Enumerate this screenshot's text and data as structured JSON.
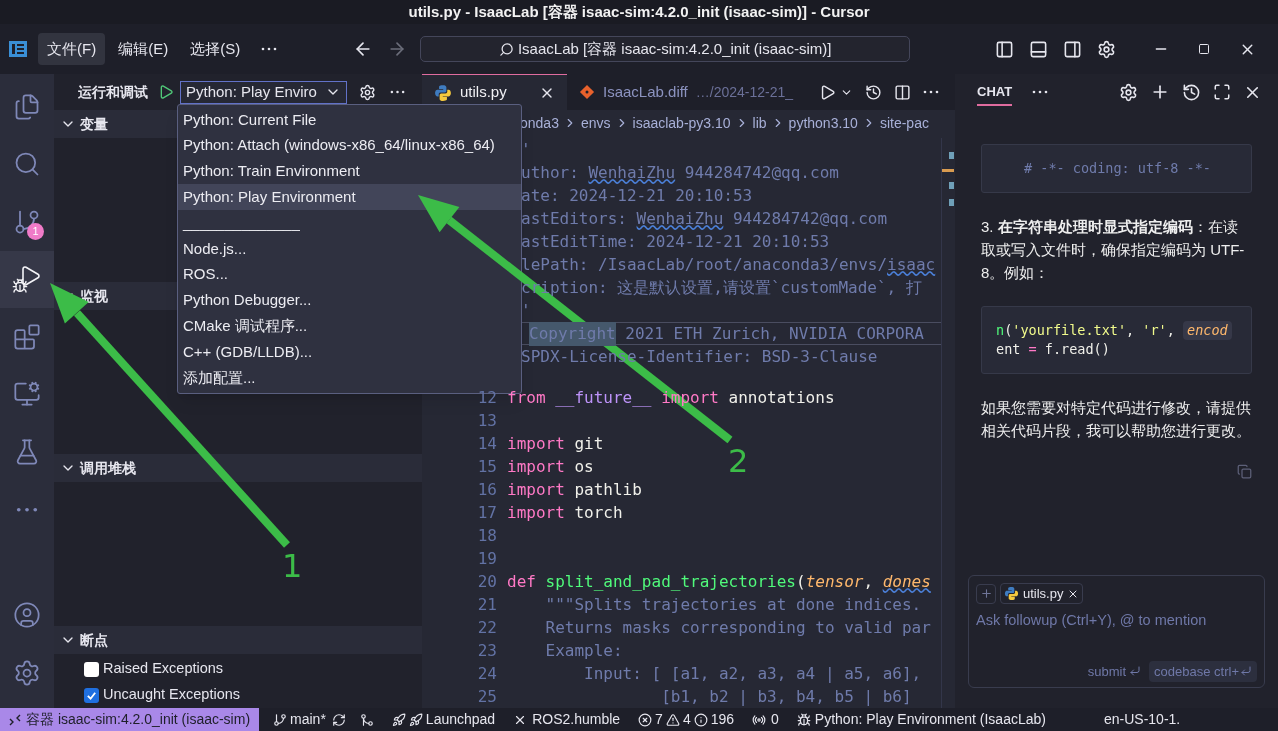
{
  "window": {
    "title": "utils.py - IsaacLab [容器 isaac-sim:4.2.0_init (isaac-sim)] - Cursor"
  },
  "menu_bar": {
    "items": [
      {
        "label": "文件(F)",
        "selected": true
      },
      {
        "label": "编辑(E)",
        "selected": false
      },
      {
        "label": "选择(S)",
        "selected": false
      }
    ]
  },
  "search": {
    "value": "IsaacLab [容器 isaac-sim:4.2.0_init (isaac-sim)]"
  },
  "activity_bar": {
    "items": [
      {
        "kind": "files",
        "selected": false
      },
      {
        "kind": "search",
        "selected": false
      },
      {
        "kind": "source_control",
        "selected": false,
        "badge": "1"
      },
      {
        "kind": "run_debug",
        "selected": true
      },
      {
        "kind": "extensions",
        "selected": false
      },
      {
        "kind": "remote",
        "selected": false
      },
      {
        "kind": "testing",
        "selected": false
      },
      {
        "kind": "more",
        "selected": false
      }
    ],
    "bottom": [
      {
        "kind": "account"
      },
      {
        "kind": "settings"
      }
    ]
  },
  "run_panel": {
    "title": "运行和调试",
    "config": "Python: Play Enviro",
    "sections": [
      {
        "title": "变量",
        "expanded": true
      },
      {
        "title": "监视",
        "expanded": true
      },
      {
        "title": "调用堆栈",
        "expanded": true
      },
      {
        "title": "断点",
        "expanded": true
      }
    ],
    "breakpoints": [
      {
        "label": "Raised Exceptions",
        "checked": false
      },
      {
        "label": "Uncaught Exceptions",
        "checked": true
      }
    ]
  },
  "launch_menu": {
    "items": [
      {
        "label": "Python: Current File",
        "selected": false
      },
      {
        "label": "Python: Attach (windows-x86_64/linux-x86_64)",
        "selected": false
      },
      {
        "label": "Python: Train Environment",
        "selected": false
      },
      {
        "label": "Python: Play Environment",
        "selected": true
      },
      {
        "label": "______________",
        "selected": false
      },
      {
        "label": "Node.js...",
        "selected": false
      },
      {
        "label": "ROS...",
        "selected": false
      },
      {
        "label": "Python Debugger...",
        "selected": false
      },
      {
        "label": "CMake 调试程序...",
        "selected": false
      },
      {
        "label": "C++ (GDB/LLDB)...",
        "selected": false
      },
      {
        "label": "添加配置...",
        "selected": false
      }
    ]
  },
  "editor": {
    "tabs": [
      {
        "kind": "python",
        "label": "utils.py",
        "selected": true
      },
      {
        "kind": "git",
        "label": "IsaacLab.diff",
        "detail": "…/2024-12-21_",
        "selected": false
      }
    ],
    "breadcrumbs": [
      "onda3",
      "envs",
      "isaaclab-py3.10",
      "lib",
      "python3.10",
      "site-pac"
    ],
    "lines": [
      {
        "current": false,
        "tokens": [
          {
            "kind": "comment",
            "text": "'"
          }
        ]
      },
      {
        "current": false,
        "tokens": [
          {
            "kind": "comment",
            "text": "uthor: "
          },
          {
            "kind": "comment_squiggle",
            "text": "WenhaiZhu"
          },
          {
            "kind": "comment",
            "text": " 944284742@qq.com"
          }
        ]
      },
      {
        "current": false,
        "tokens": [
          {
            "kind": "comment",
            "text": "ate: 2024-12-21 20:10:53"
          }
        ]
      },
      {
        "current": false,
        "tokens": [
          {
            "kind": "comment",
            "text": "astEditors: "
          },
          {
            "kind": "comment_squiggle",
            "text": "WenhaiZhu"
          },
          {
            "kind": "comment",
            "text": " 944284742@qq.com"
          }
        ]
      },
      {
        "current": false,
        "tokens": [
          {
            "kind": "comment",
            "text": "astEditTime: 2024-12-21 20:10:53"
          }
        ]
      },
      {
        "current": false,
        "tokens": [
          {
            "kind": "comment",
            "text": "lePath: /IsaacLab/root/anaconda3/envs/"
          },
          {
            "kind": "comment_squiggle",
            "text": "isaac"
          }
        ]
      },
      {
        "current": false,
        "tokens": [
          {
            "kind": "comment",
            "text": "cription: 这是默认设置,请设置`customMade`, 打"
          }
        ]
      },
      {
        "current": false,
        "tokens": [
          {
            "kind": "comment",
            "text": "'"
          }
        ]
      },
      {
        "current": true,
        "tokens": [
          {
            "kind": "selection",
            "text": "Copyright"
          },
          {
            "kind": "comment",
            "text": " 2021 ETH Zurich, NVIDIA CORPORA"
          }
        ]
      },
      {
        "current": false,
        "tokens": [
          {
            "kind": "comment",
            "text": "SPDX-License-Identifier: BSD-3-Clause"
          }
        ]
      },
      {
        "current": false
      },
      {
        "number": "12",
        "current": false,
        "tokens": [
          {
            "kind": "keyword",
            "text": "from"
          },
          {
            "kind": "module",
            "text": " __future__ "
          },
          {
            "kind": "keyword",
            "text": "import"
          },
          {
            "kind": "name",
            "text": " annotations"
          }
        ]
      },
      {
        "number": "13",
        "current": false
      },
      {
        "number": "14",
        "current": false,
        "tokens": [
          {
            "kind": "keyword",
            "text": "import"
          },
          {
            "kind": "name",
            "text": " git"
          }
        ]
      },
      {
        "number": "15",
        "current": false,
        "tokens": [
          {
            "kind": "keyword",
            "text": "import"
          },
          {
            "kind": "name",
            "text": " os"
          }
        ]
      },
      {
        "number": "16",
        "current": false,
        "tokens": [
          {
            "kind": "keyword",
            "text": "import"
          },
          {
            "kind": "name",
            "text": " pathlib"
          }
        ]
      },
      {
        "number": "17",
        "current": false,
        "tokens": [
          {
            "kind": "keyword",
            "text": "import"
          },
          {
            "kind": "name",
            "text": " torch"
          }
        ]
      },
      {
        "number": "18",
        "current": false
      },
      {
        "number": "19",
        "current": false
      },
      {
        "number": "20",
        "current": false,
        "tokens": [
          {
            "kind": "keyword",
            "text": "def "
          },
          {
            "kind": "function",
            "text": "split_and_pad_trajectories"
          },
          {
            "kind": "name",
            "text": "("
          },
          {
            "kind": "param",
            "text": "tensor"
          },
          {
            "kind": "name",
            "text": ", "
          },
          {
            "kind": "param_squiggle",
            "text": "dones"
          }
        ]
      },
      {
        "number": "21",
        "current": false,
        "tokens": [
          {
            "kind": "comment",
            "text": "    \"\"\"Splits trajectories at done indices."
          }
        ]
      },
      {
        "number": "22",
        "current": false,
        "tokens": [
          {
            "kind": "comment",
            "text": "    Returns masks corresponding to valid par"
          }
        ]
      },
      {
        "number": "23",
        "current": false,
        "tokens": [
          {
            "kind": "comment",
            "text": "    Example:"
          }
        ]
      },
      {
        "number": "24",
        "current": false,
        "tokens": [
          {
            "kind": "comment",
            "text": "        Input: [ [a1, a2, a3, a4 | a5, a6],"
          }
        ]
      },
      {
        "number": "25",
        "current": false,
        "tokens": [
          {
            "kind": "comment",
            "text": "                [b1, b2 | b3, b4, b5 | b6]"
          }
        ]
      }
    ]
  },
  "chat": {
    "title": "CHAT",
    "blocks": [
      {
        "kind": "code",
        "lines": [
          [
            {
              "kind": "comment",
              "text": "# -*- coding: utf-8 -*-"
            }
          ]
        ]
      },
      {
        "kind": "text",
        "text": "3. **在字符串处理时显式指定编码**：在读取或写入文件时，确保指定编码为 UTF-8。例如："
      },
      {
        "kind": "code",
        "lines": [
          [
            {
              "kind": "function",
              "text": "n"
            },
            {
              "kind": "name",
              "text": "("
            },
            {
              "kind": "string",
              "text": "'yourfile.txt'"
            },
            {
              "kind": "name",
              "text": ", "
            },
            {
              "kind": "string",
              "text": "'r'"
            },
            {
              "kind": "name",
              "text": ", "
            },
            {
              "kind": "param_box",
              "text": "encod"
            }
          ],
          [
            {
              "kind": "name",
              "text": "ent "
            },
            {
              "kind": "keyword",
              "text": "="
            },
            {
              "kind": "name",
              "text": " f.read()"
            }
          ]
        ]
      },
      {
        "kind": "text",
        "text": "如果您需要对特定代码进行修改，请提供相关代码片段，我可以帮助您进行更改。"
      }
    ],
    "context_chip": "utils.py",
    "input": {
      "placeholder": "Ask followup (Ctrl+Y), @ to mention"
    },
    "submit": "submit",
    "codebase": "codebase ctrl+"
  },
  "status_bar": {
    "remote": "容器 isaac-sim:4.2.0_init (isaac-sim)",
    "items": [
      {
        "kind": "branch",
        "text": "main*"
      },
      {
        "kind": "sync"
      },
      {
        "kind": "merge"
      },
      {
        "kind": "launchpad",
        "text": "Launchpad"
      },
      {
        "kind": "ros",
        "text": "ROS2.humble"
      },
      {
        "kind": "problems",
        "errors": "7",
        "warnings": "4",
        "infos": "196"
      },
      {
        "kind": "ports",
        "text": "0"
      },
      {
        "kind": "debug",
        "text": "Python: Play Environment (IsaacLab)"
      },
      {
        "kind": "locale",
        "text": "en-US-10-1."
      }
    ]
  },
  "annotations": [
    {
      "label": "1"
    },
    {
      "label": "2"
    }
  ]
}
